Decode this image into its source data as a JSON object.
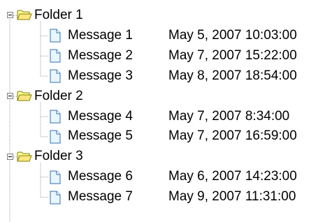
{
  "tree": {
    "folders": [
      {
        "label": "Folder 1",
        "expanded": true,
        "messages": [
          {
            "name": "Message 1",
            "date": "May 5, 2007 10:03:00"
          },
          {
            "name": "Message 2",
            "date": "May 7, 2007 15:22:00"
          },
          {
            "name": "Message 3",
            "date": "May 8, 2007 18:54:00"
          }
        ]
      },
      {
        "label": "Folder 2",
        "expanded": true,
        "messages": [
          {
            "name": "Message 4",
            "date": "May 7, 2007 8:34:00"
          },
          {
            "name": "Message 5",
            "date": "May 7, 2007 16:59:00"
          }
        ]
      },
      {
        "label": "Folder 3",
        "expanded": true,
        "messages": [
          {
            "name": "Message 6",
            "date": "May 6, 2007 14:23:00"
          },
          {
            "name": "Message 7",
            "date": "May 9, 2007 11:31:00"
          }
        ]
      }
    ]
  },
  "icons": {
    "folder": "folder-open-icon",
    "message": "document-icon",
    "expander": "collapse-minus-icon"
  },
  "colors": {
    "folder_fill": "#ffff99",
    "folder_edge": "#808000",
    "doc_fill": "#e8f6ff",
    "doc_edge": "#2f6fb5",
    "tree_line": "#a0a0a0"
  }
}
